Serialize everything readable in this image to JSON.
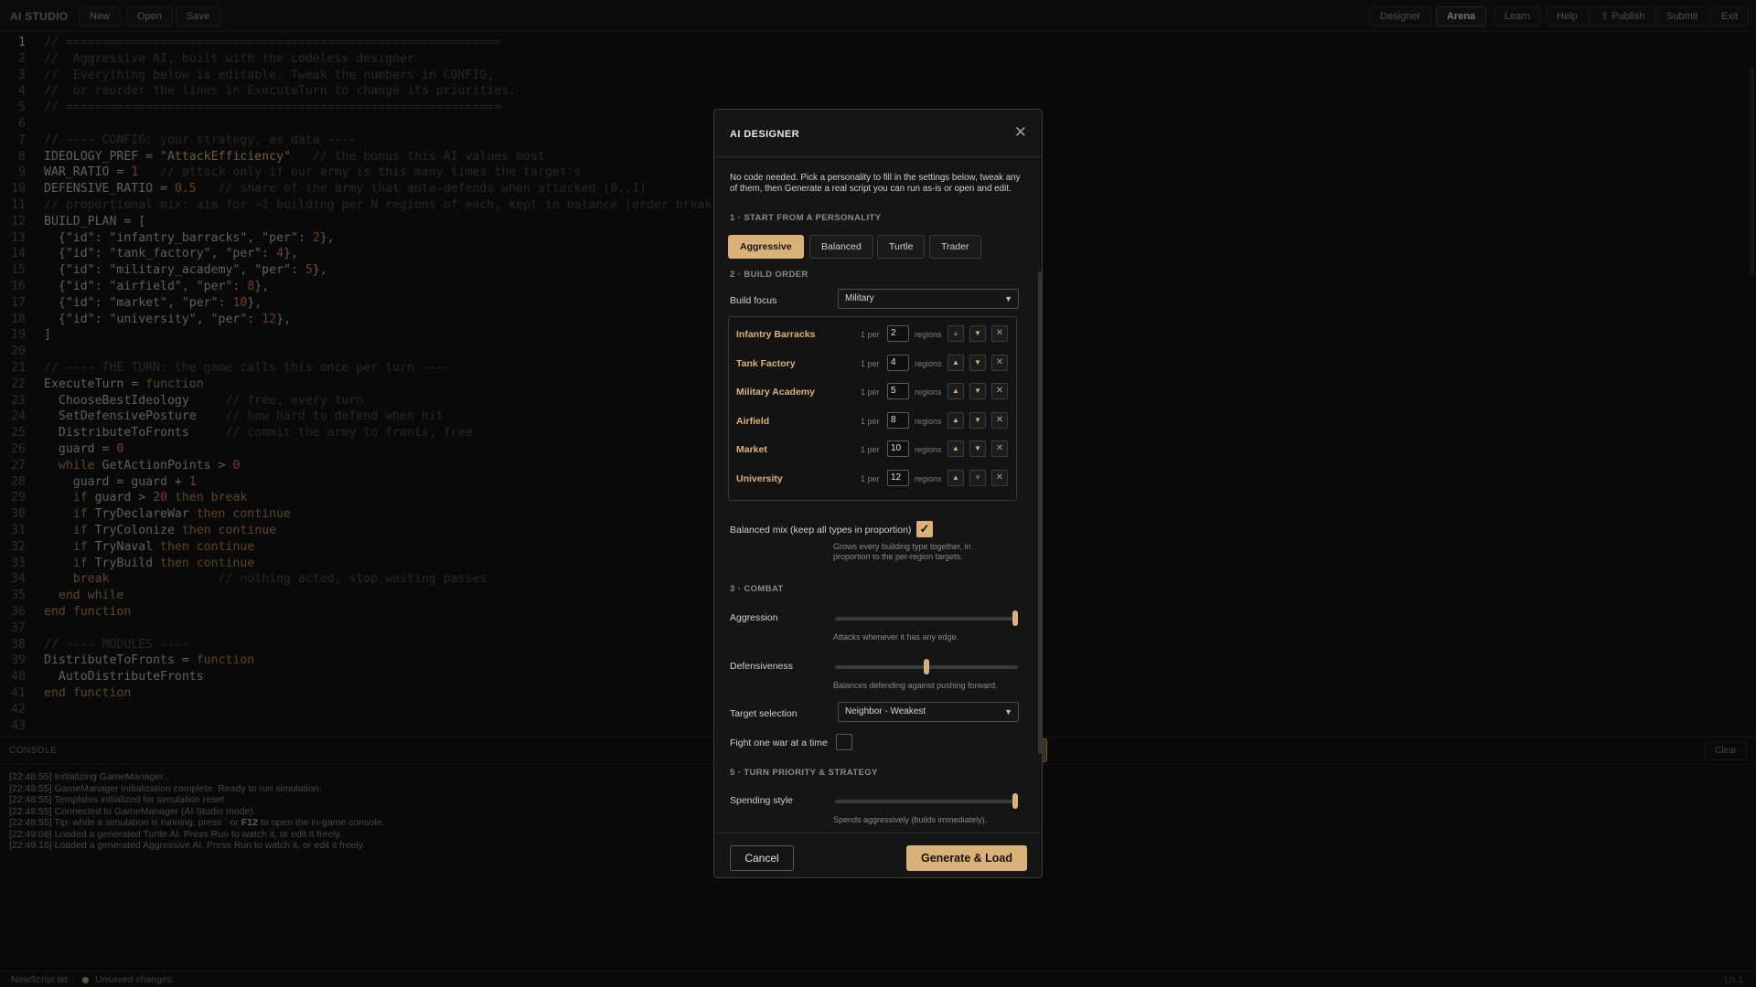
{
  "app": {
    "brand": "AI STUDIO",
    "toolbar_left": [
      "New",
      "Open",
      "Save"
    ],
    "toolbar_right": [
      "Designer",
      "Arena",
      "Learn",
      "Help",
      "⇧ Publish",
      "Submit",
      "Exit"
    ],
    "active_tab": "Arena"
  },
  "editor": {
    "current_line": 1,
    "lines": [
      [
        [
          "c",
          "// ============================================================"
        ]
      ],
      [
        [
          "c",
          "//  Aggressive AI, built with the codeless designer"
        ]
      ],
      [
        [
          "c",
          "//  Everything below is editable. Tweak the numbers in CONFIG,"
        ]
      ],
      [
        [
          "c",
          "//  or reorder the lines in ExecuteTurn to change its priorities."
        ]
      ],
      [
        [
          "c",
          "// ============================================================"
        ]
      ],
      [],
      [
        [
          "c",
          "// ---- CONFIG: your strategy, as data ----"
        ]
      ],
      [
        [
          "t",
          "IDEOLOGY_PREF = "
        ],
        [
          "s",
          "\"AttackEfficiency\""
        ],
        [
          "c",
          "   // the bonus this AI values most"
        ]
      ],
      [
        [
          "t",
          "WAR_RATIO = "
        ],
        [
          "n",
          "1"
        ],
        [
          "c",
          "   // attack only if our army is this many times the target's"
        ]
      ],
      [
        [
          "t",
          "DEFENSIVE_RATIO = "
        ],
        [
          "n",
          "0.5"
        ],
        [
          "c",
          "   // share of the army that auto-defends when attacked (0..1)"
        ]
      ],
      [
        [
          "c",
          "// proportional mix: aim for ~1 building per N regions of each, kept in balance (order breaks ties)"
        ]
      ],
      [
        [
          "t",
          "BUILD_PLAN = ["
        ]
      ],
      [
        [
          "t",
          "  {\"id\": \"infantry_barracks\", \"per\": "
        ],
        [
          "n",
          "2"
        ],
        [
          "t",
          "},"
        ]
      ],
      [
        [
          "t",
          "  {\"id\": \"tank_factory\", \"per\": "
        ],
        [
          "n",
          "4"
        ],
        [
          "t",
          "},"
        ]
      ],
      [
        [
          "t",
          "  {\"id\": \"military_academy\", \"per\": "
        ],
        [
          "n",
          "5"
        ],
        [
          "t",
          "},"
        ]
      ],
      [
        [
          "t",
          "  {\"id\": \"airfield\", \"per\": "
        ],
        [
          "n",
          "8"
        ],
        [
          "t",
          "},"
        ]
      ],
      [
        [
          "t",
          "  {\"id\": \"market\", \"per\": "
        ],
        [
          "n",
          "10"
        ],
        [
          "t",
          "},"
        ]
      ],
      [
        [
          "t",
          "  {\"id\": \"university\", \"per\": "
        ],
        [
          "n",
          "12"
        ],
        [
          "t",
          "},"
        ]
      ],
      [
        [
          "t",
          "]"
        ]
      ],
      [],
      [
        [
          "c",
          "// ---- THE TURN: the game calls this once per turn ----"
        ]
      ],
      [
        [
          "t",
          "ExecuteTurn = "
        ],
        [
          "k",
          "function"
        ]
      ],
      [
        [
          "t",
          "  ChooseBestIdeology     "
        ],
        [
          "c",
          "// free, every turn"
        ]
      ],
      [
        [
          "t",
          "  SetDefensivePosture    "
        ],
        [
          "c",
          "// how hard to defend when hit"
        ]
      ],
      [
        [
          "t",
          "  DistributeToFronts     "
        ],
        [
          "c",
          "// commit the army to fronts, free"
        ]
      ],
      [
        [
          "t",
          "  guard = "
        ],
        [
          "n",
          "0"
        ]
      ],
      [
        [
          "k",
          "  while"
        ],
        [
          "t",
          " GetActionPoints > "
        ],
        [
          "n",
          "0"
        ]
      ],
      [
        [
          "t",
          "    guard = guard + "
        ],
        [
          "n",
          "1"
        ]
      ],
      [
        [
          "k",
          "    if"
        ],
        [
          "t",
          " guard > "
        ],
        [
          "n",
          "20"
        ],
        [
          "k",
          " then break"
        ]
      ],
      [
        [
          "k",
          "    if"
        ],
        [
          "t",
          " TryDeclareWar "
        ],
        [
          "k",
          "then continue"
        ]
      ],
      [
        [
          "k",
          "    if"
        ],
        [
          "t",
          " TryColonize "
        ],
        [
          "k",
          "then continue"
        ]
      ],
      [
        [
          "k",
          "    if"
        ],
        [
          "t",
          " TryNaval "
        ],
        [
          "k",
          "then continue"
        ]
      ],
      [
        [
          "k",
          "    if"
        ],
        [
          "t",
          " TryBuild "
        ],
        [
          "k",
          "then continue"
        ]
      ],
      [
        [
          "k",
          "    break"
        ],
        [
          "c",
          "               // nothing acted, stop wasting passes"
        ]
      ],
      [
        [
          "k",
          "  end while"
        ]
      ],
      [
        [
          "k",
          "end function"
        ]
      ],
      [],
      [
        [
          "c",
          "// ---- MODULES ----"
        ]
      ],
      [
        [
          "t",
          "DistributeToFronts = "
        ],
        [
          "k",
          "function"
        ]
      ],
      [
        [
          "t",
          "  AutoDistributeFronts"
        ]
      ],
      [
        [
          "k",
          "end function"
        ]
      ],
      [],
      []
    ]
  },
  "console": {
    "title": "CONSOLE",
    "clear_label": "Clear",
    "logs": [
      [
        "[22:48:55] Initializing GameManager...",
        "",
        ""
      ],
      [
        "[22:48:55] GameManager initialization complete. Ready to run simulation.",
        "",
        ""
      ],
      [
        "[22:48:55] Templates initialized for simulation reset",
        "",
        ""
      ],
      [
        "[22:48:55] Connected to GameManager (AI Studio mode).",
        "",
        ""
      ],
      [
        "[22:48:55] Tip: while a simulation is running, press ` or ",
        "F12",
        " to open the in-game console."
      ],
      [
        "[22:49:08] Loaded a generated Turtle AI. Press Run to watch it, or edit it freely.",
        "",
        ""
      ],
      [
        "[22:49:16] Loaded a generated Aggressive AI. Press Run to watch it, or edit it freely.",
        "",
        ""
      ]
    ]
  },
  "status": {
    "file": "NewScript.txt",
    "unsaved": "Unsaved changes",
    "position": "Ln 1"
  },
  "dialog": {
    "title": "AI DESIGNER",
    "intro": "No code needed. Pick a personality to fill in the settings below, tweak any of them, then Generate a real script you can run as-is or open and edit.",
    "section1": "1 · START FROM A PERSONALITY",
    "personalities": [
      "Aggressive",
      "Balanced",
      "Turtle",
      "Trader"
    ],
    "active_personality": "Aggressive",
    "section2": "2 · BUILD ORDER",
    "build_focus_label": "Build focus",
    "build_focus_value": "Military",
    "per_label": "1 per",
    "regions_label": "regions",
    "buildings": [
      {
        "name": "Infantry Barracks",
        "per": "2"
      },
      {
        "name": "Tank Factory",
        "per": "4"
      },
      {
        "name": "Military Academy",
        "per": "5"
      },
      {
        "name": "Airfield",
        "per": "8"
      },
      {
        "name": "Market",
        "per": "10"
      },
      {
        "name": "University",
        "per": "12"
      }
    ],
    "balanced_label": "Balanced mix (keep all types in proportion)",
    "balanced_checked": true,
    "balanced_help": "Grows every building type together, in proportion to the per-region targets.",
    "section3": "3 · COMBAT",
    "aggression_label": "Aggression",
    "aggression_value": 1.0,
    "aggression_help": "Attacks whenever it has any edge.",
    "defensiveness_label": "Defensiveness",
    "defensiveness_value": 0.5,
    "defensiveness_help": "Balances defending against pushing forward.",
    "target_label": "Target selection",
    "target_value": "Neighbor - Weakest",
    "one_war_label": "Fight one war at a time",
    "one_war_checked": false,
    "section5": "5 · TURN PRIORITY & STRATEGY",
    "spending_label": "Spending style",
    "spending_value": 1.0,
    "spending_help": "Spends aggressively (builds immediately).",
    "cancel_label": "Cancel",
    "generate_label": "Generate & Load"
  },
  "icons": {
    "close": "close-icon",
    "up": "arrow-up-icon",
    "down": "arrow-down-icon",
    "remove": "remove-icon",
    "check": "check-icon",
    "dropdown": "chevron-down-icon"
  },
  "colors": {
    "accent": "#d9b27a",
    "background": "#111111",
    "comment": "#4f4f4f",
    "keyword": "#b08a55",
    "string": "#d6b278",
    "number": "#d9823e"
  }
}
